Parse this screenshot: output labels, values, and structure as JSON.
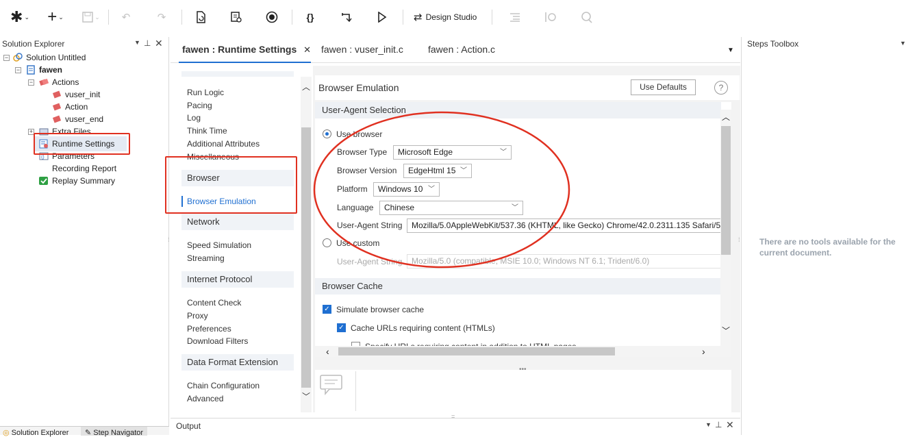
{
  "toolbar": {
    "design_studio_label": "Design Studio"
  },
  "solution_explorer": {
    "title": "Solution Explorer",
    "tree": [
      {
        "label": "Solution Untitled"
      },
      {
        "label": "fawen"
      },
      {
        "label": "Actions"
      },
      {
        "label": "vuser_init"
      },
      {
        "label": "Action"
      },
      {
        "label": "vuser_end"
      },
      {
        "label": "Extra Files"
      },
      {
        "label": "Runtime Settings"
      },
      {
        "label": "Parameters"
      },
      {
        "label": "Recording Report"
      },
      {
        "label": "Replay Summary"
      }
    ],
    "bottom_tabs": [
      "Solution Explorer",
      "Step Navigator"
    ]
  },
  "editor_tabs": [
    {
      "label": "fawen : Runtime Settings",
      "active": true
    },
    {
      "label": "fawen : vuser_init.c",
      "active": false
    },
    {
      "label": "fawen : Action.c",
      "active": false
    }
  ],
  "nav": {
    "general_items": [
      "Run Logic",
      "Pacing",
      "Log",
      "Think Time",
      "Additional Attributes",
      "Miscellaneous"
    ],
    "sections": [
      {
        "title": "Browser",
        "items": [
          "Browser Emulation"
        ]
      },
      {
        "title": "Network",
        "items": [
          "Speed Simulation",
          "Streaming"
        ]
      },
      {
        "title": "Internet Protocol",
        "items": [
          "Content Check",
          "Proxy",
          "Preferences",
          "Download Filters"
        ]
      },
      {
        "title": "Data Format Extension",
        "items": [
          "Chain Configuration",
          "Advanced"
        ]
      }
    ]
  },
  "main": {
    "title": "Browser Emulation",
    "use_defaults_label": "Use Defaults",
    "help_label": "?",
    "ua_section": "User-Agent Selection",
    "use_browser_label": "Use browser",
    "browser_type_label": "Browser Type",
    "browser_type_value": "Microsoft Edge",
    "browser_version_label": "Browser Version",
    "browser_version_value": "EdgeHtml 15",
    "platform_label": "Platform",
    "platform_value": "Windows 10",
    "language_label": "Language",
    "language_value": "Chinese",
    "ua_string_label": "User-Agent String",
    "ua_string_value": "Mozilla/5.0AppleWebKit/537.36 (KHTML, like Gecko) Chrome/42.0.2311.135 Safari/5",
    "use_custom_label": "Use custom",
    "custom_ua_label": "User-Agent String",
    "custom_ua_value": "Mozilla/5.0 (compatible; MSIE 10.0; Windows NT 6.1; Trident/6.0)",
    "cache_section": "Browser Cache",
    "simulate_cache_label": "Simulate browser cache",
    "cache_urls_label": "Cache URLs requiring content (HTMLs)",
    "specify_urls_label": "Specify URLs requiring content in addition to HTML pages"
  },
  "steps_toolbox": {
    "title": "Steps Toolbox",
    "empty_message": "There are no tools available for the current document."
  },
  "output": {
    "title": "Output"
  },
  "colors": {
    "accent": "#1f6fd1",
    "annotation": "#e03020"
  }
}
